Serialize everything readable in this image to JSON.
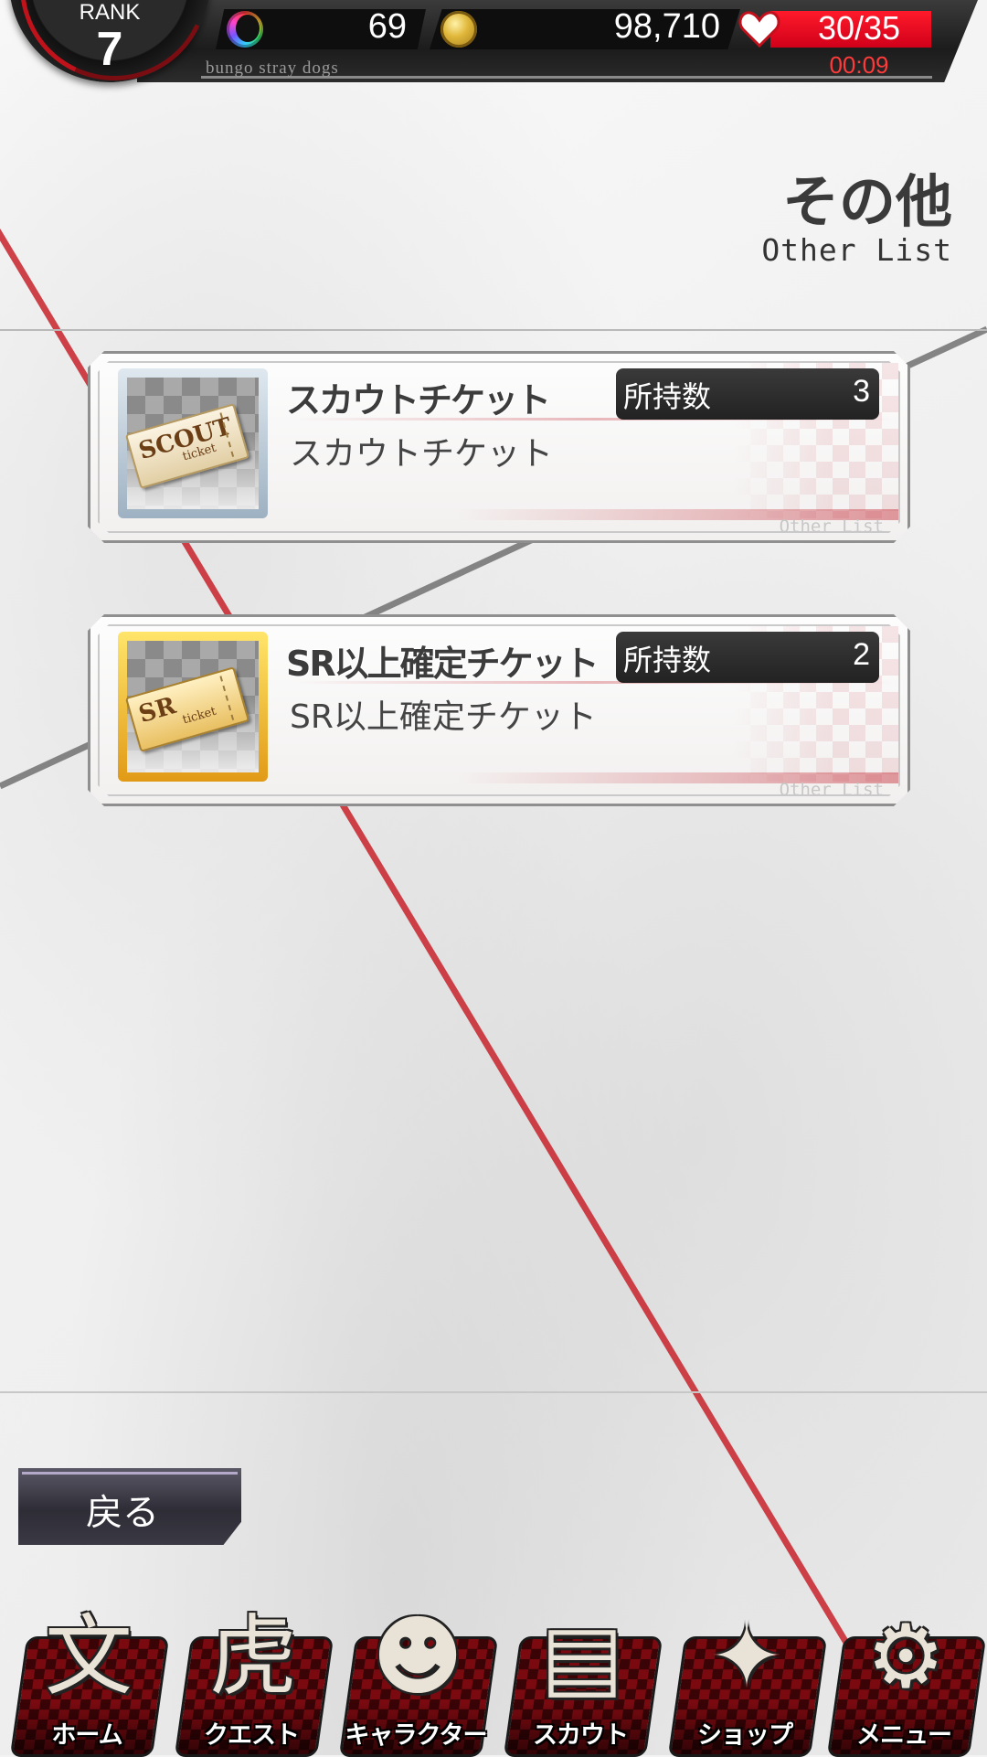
{
  "status_bar": {
    "rank_label": "RANK",
    "rank_value": "7",
    "gems": "69",
    "coins": "98,710",
    "ap": "30/35",
    "ap_timer": "00:09",
    "game_name": "bungo stray dogs",
    "accent_color": "#e0001b",
    "icons": [
      "rainbow-crescent-gem-icon",
      "gold-coin-icon",
      "ap-heart-icon"
    ]
  },
  "header": {
    "title": "その他",
    "subtitle": "Other List"
  },
  "items": [
    {
      "name": "スカウトチケット",
      "description": "スカウトチケット",
      "owned_label": "所持数",
      "owned_count": "3",
      "tag": "Other List",
      "ticket_text": "SCOUT",
      "ticket_sub": "ticket",
      "frame": "silver"
    },
    {
      "name": "SR以上確定チケット",
      "description": "SR以上確定チケット",
      "owned_label": "所持数",
      "owned_count": "2",
      "tag": "Other List",
      "ticket_text": "SR",
      "ticket_sub": "ticket",
      "frame": "gold"
    }
  ],
  "back_button": {
    "label": "戻る"
  },
  "nav": [
    {
      "label": "ホーム",
      "icon": "home-kanji-icon",
      "glyph": "文"
    },
    {
      "label": "クエスト",
      "icon": "tiger-head-icon",
      "glyph": "虎"
    },
    {
      "label": "キャラクター",
      "icon": "characters-icon",
      "glyph": "☻"
    },
    {
      "label": "スカウト",
      "icon": "scout-book-icon",
      "glyph": "▤"
    },
    {
      "label": "ショップ",
      "icon": "shop-cart-icon",
      "glyph": "✦"
    },
    {
      "label": "メニュー",
      "icon": "gear-icon",
      "glyph": "⚙"
    }
  ]
}
